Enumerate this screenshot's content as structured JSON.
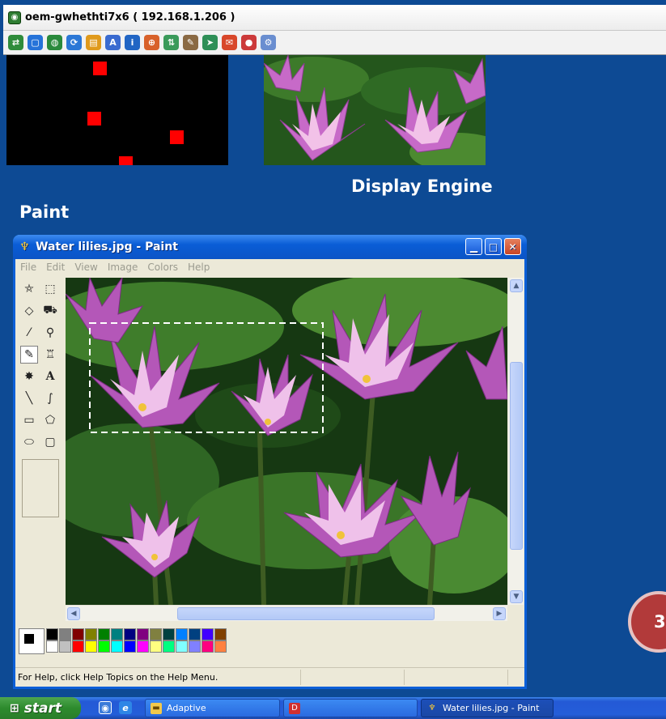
{
  "vnc": {
    "title": "oem-gwhethti7x6 ( 192.168.1.206 )",
    "toolbar_icons": [
      "connection-options-icon",
      "fullscreen-icon",
      "globe-icon",
      "refresh-icon",
      "clipboard-icon",
      "font-icon",
      "info-icon",
      "zoom-icon",
      "transfer-icon",
      "tools-icon",
      "send-icon",
      "chat-icon",
      "record-icon",
      "settings-icon"
    ]
  },
  "labels": {
    "display_engine": "Display Engine",
    "paint": "Paint"
  },
  "paint": {
    "title": "Water lilies.jpg - Paint",
    "menu": [
      "File",
      "Edit",
      "View",
      "Image",
      "Colors",
      "Help"
    ],
    "status": "For Help, click Help Topics on the Help Menu.",
    "palette_top": [
      "#000000",
      "#808080",
      "#800000",
      "#808000",
      "#008000",
      "#008080",
      "#000080",
      "#800080",
      "#808040",
      "#004040",
      "#0080ff",
      "#004080",
      "#4000ff",
      "#804000"
    ],
    "palette_bottom": [
      "#ffffff",
      "#c0c0c0",
      "#ff0000",
      "#ffff00",
      "#00ff00",
      "#00ffff",
      "#0000ff",
      "#ff00ff",
      "#ffff80",
      "#00ff80",
      "#80ffff",
      "#8080ff",
      "#ff0080",
      "#ff8040"
    ]
  },
  "taskbar": {
    "start": "start",
    "items": [
      {
        "label": "Adaptive"
      },
      {
        "label": ""
      },
      {
        "label": "Water lilies.jpg - Paint"
      }
    ]
  },
  "badge": "3"
}
